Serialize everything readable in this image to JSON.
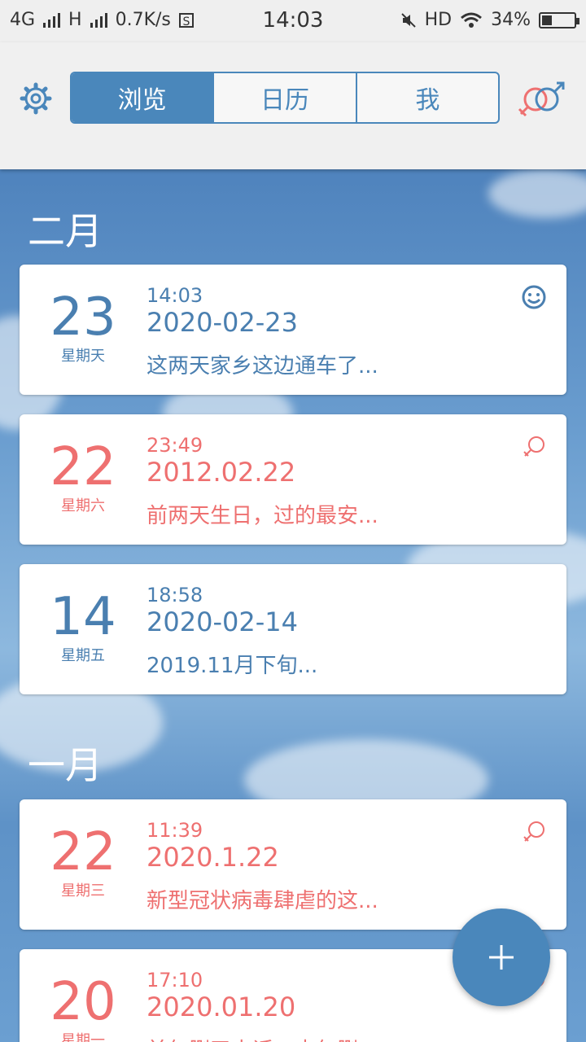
{
  "status_bar": {
    "network": "4G",
    "network2": "H",
    "speed": "0.7K/s",
    "s_icon": "S",
    "time": "14:03",
    "hd": "HD",
    "battery": "34%",
    "battery_level": 0.34
  },
  "header": {
    "tabs": [
      {
        "label": "浏览",
        "active": true
      },
      {
        "label": "日历",
        "active": false
      },
      {
        "label": "我",
        "active": false
      }
    ],
    "settings_icon": "gear-icon",
    "gender_icon": "gender-icon"
  },
  "colors": {
    "accent": "#4a87bb",
    "female": "#ee7070",
    "male": "#4a7fb0"
  },
  "months": [
    {
      "label": "二月",
      "entries": [
        {
          "day": "23",
          "weekday": "星期天",
          "time": "14:03",
          "date": "2020-02-23",
          "text": "这两天家乡这边通车了...",
          "color": "blue",
          "icon": "smiley-icon"
        },
        {
          "day": "22",
          "weekday": "星期六",
          "time": "23:49",
          "date": "2012.02.22",
          "text": "前两天生日，过的最安...",
          "color": "red",
          "icon": "female-icon"
        },
        {
          "day": "14",
          "weekday": "星期五",
          "time": "18:58",
          "date": "2020-02-14",
          "text": "2019.11月下旬...",
          "color": "blue",
          "icon": ""
        }
      ]
    },
    {
      "label": "一月",
      "entries": [
        {
          "day": "22",
          "weekday": "星期三",
          "time": "11:39",
          "date": "2020.1.22",
          "text": "新型冠状病毒肆虐的这...",
          "color": "red",
          "icon": "female-icon"
        },
        {
          "day": "20",
          "weekday": "星期一",
          "time": "17:10",
          "date": "2020.01.20",
          "text": "前年删了电话，去年删...",
          "color": "red",
          "icon": "female-icon"
        }
      ]
    }
  ],
  "fab": {
    "label": "+"
  }
}
